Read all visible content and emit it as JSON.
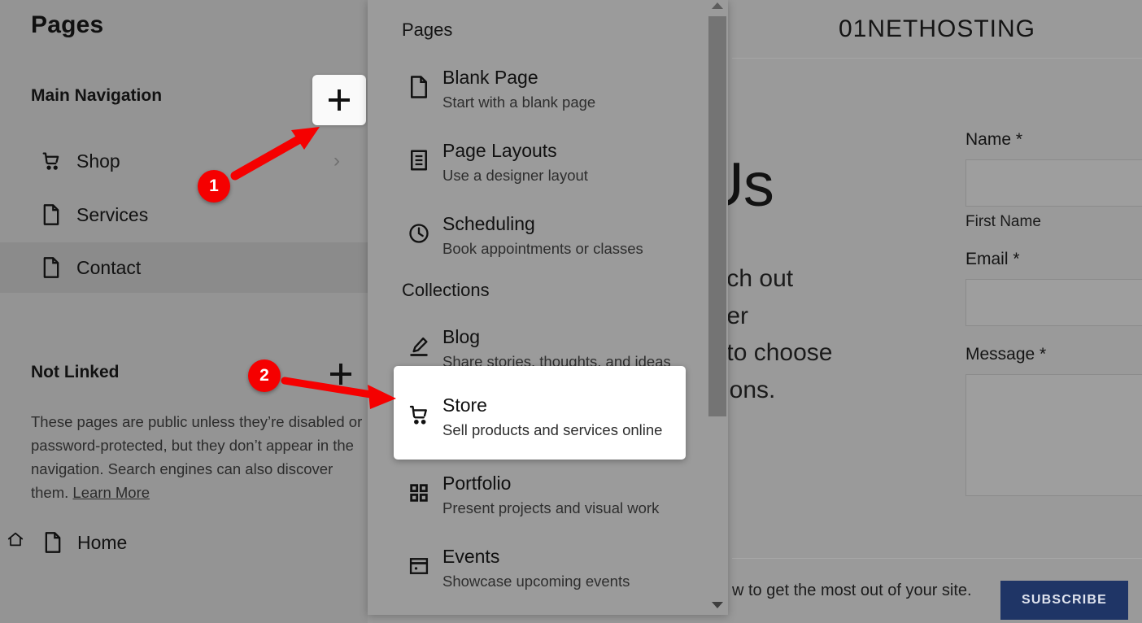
{
  "sidebar": {
    "title": "Pages",
    "sections": {
      "main_navigation": "Main Navigation",
      "not_linked": "Not Linked"
    },
    "add_button_label": "+",
    "nav_items": [
      {
        "label": "Shop",
        "icon": "shopping-cart-icon",
        "has_chevron": true
      },
      {
        "label": "Services",
        "icon": "page-icon",
        "has_chevron": false
      },
      {
        "label": "Contact",
        "icon": "page-icon",
        "has_chevron": false,
        "active": true
      }
    ],
    "not_linked_description": "These pages are public unless they’re disabled or password-protected, but they don’t appear in the navigation. Search engines can also discover them. ",
    "learn_more": "Learn More",
    "not_linked_items": [
      {
        "label": "Home",
        "icon": "page-icon",
        "prefix_icon": "home-icon"
      }
    ]
  },
  "dropdown": {
    "groups": [
      {
        "label": "Pages",
        "items": [
          {
            "title": "Blank Page",
            "desc": "Start with a blank page",
            "icon": "page-icon"
          },
          {
            "title": "Page Layouts",
            "desc": "Use a designer layout",
            "icon": "layout-icon"
          },
          {
            "title": "Scheduling",
            "desc": "Book appointments or classes",
            "icon": "clock-icon"
          }
        ]
      },
      {
        "label": "Collections",
        "items": [
          {
            "title": "Blog",
            "desc": "Share stories, thoughts, and ideas",
            "icon": "pen-icon"
          },
          {
            "title": "Store",
            "desc": "Sell products and services online",
            "icon": "shopping-cart-icon",
            "highlighted": true
          },
          {
            "title": "Portfolio",
            "desc": "Present projects and visual work",
            "icon": "grid-icon"
          },
          {
            "title": "Events",
            "desc": "Showcase upcoming events",
            "icon": "calendar-icon"
          }
        ]
      }
    ]
  },
  "site": {
    "logo": "01NETHOSTING",
    "hero_heading": "Us",
    "hero_body_lines": [
      "each out",
      "after",
      "et to choose",
      "ssions."
    ],
    "form": {
      "name_label": "Name *",
      "first_name_sub": "First Name",
      "email_label": "Email *",
      "message_label": "Message *"
    },
    "footer_text": "w to get the most out of your site.",
    "subscribe_label": "SUBSCRIBE"
  },
  "annotations": {
    "steps": [
      {
        "number": "1",
        "target": "add-page-button"
      },
      {
        "number": "2",
        "target": "add-not-linked-page-button"
      }
    ]
  },
  "colors": {
    "accent_red": "#f50000",
    "subscribe_blue": "#1f3566",
    "panel_bg": "#9b9b9b",
    "sidebar_bg": "#949494",
    "highlight_card": "#ffffff"
  }
}
